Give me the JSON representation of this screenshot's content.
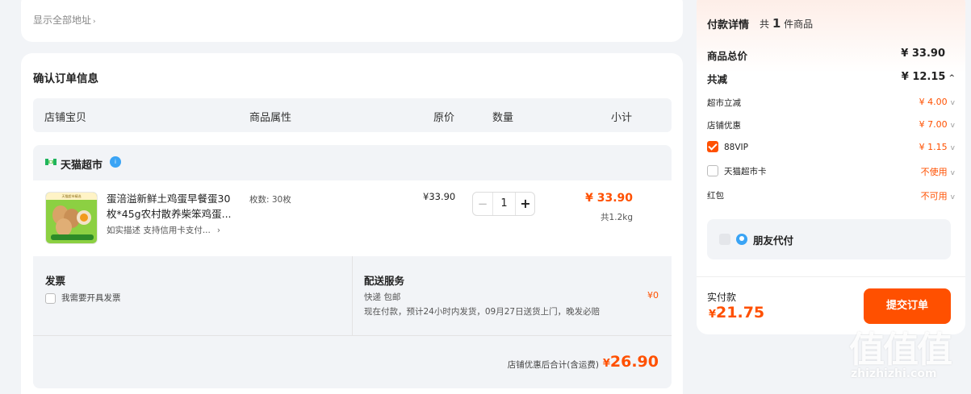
{
  "address": {
    "show_all": "显示全部地址",
    "chevron": "›"
  },
  "order": {
    "title": "确认订单信息",
    "columns": {
      "shop_item": "店铺宝贝",
      "attr": "商品属性",
      "price": "原价",
      "qty": "数量",
      "subtotal": "小计"
    },
    "shop": {
      "name": "天猫超市",
      "badge": "i",
      "item": {
        "thumb_banner": "天猫超市精选",
        "title": "蛋涪溢新鲜土鸡蛋早餐蛋30枚*45g农村散养柴笨鸡蛋...",
        "desc": "如实描述  支持信用卡支付...",
        "desc_arrow": "›",
        "attr": "枚数: 30枚",
        "price": "¥33.90",
        "qty": "1",
        "minus": "−",
        "plus": "+",
        "subtotal": "¥ 33.90",
        "weight": "共1.2kg"
      },
      "invoice": {
        "title": "发票",
        "option": "我需要开具发票"
      },
      "shipping": {
        "title": "配送服务",
        "method": "快递 包邮",
        "eta": "现在付款，预计24小时内发货，09月27日送货上门，晚发必赔",
        "fee": "¥0"
      },
      "total_label": "店铺优惠后合计(含运费)",
      "total_currency": "¥",
      "total_value": "26.90"
    }
  },
  "payment": {
    "title": "付款详情",
    "count_prefix": "共",
    "count": "1",
    "count_suffix": "件商品",
    "goods_total_label": "商品总价",
    "goods_total": "¥ 33.90",
    "discount_label": "共减",
    "discount": "¥ 12.15",
    "discount_caret": "^",
    "items": [
      {
        "label": "超市立减",
        "value": "¥ 4.00",
        "caret": "v"
      },
      {
        "label": "店铺优惠",
        "value": "¥ 7.00",
        "caret": "v"
      },
      {
        "label": "88VIP",
        "value": "¥ 1.15",
        "caret": "v"
      },
      {
        "label": "天猫超市卡",
        "value": "不使用",
        "caret": "v"
      },
      {
        "label": "红包",
        "value": "不可用",
        "caret": "v"
      }
    ],
    "friend_pay": "朋友代付",
    "actual_label": "实付款",
    "actual_currency": "¥",
    "actual_value": "21.75",
    "submit": "提交订单"
  },
  "watermark": {
    "big": "值值值",
    "site": "zhizhizhi.com"
  },
  "colors": {
    "accent": "#ff5000",
    "bg": "#f2f4f7",
    "info_blue": "#3aa4f5"
  }
}
